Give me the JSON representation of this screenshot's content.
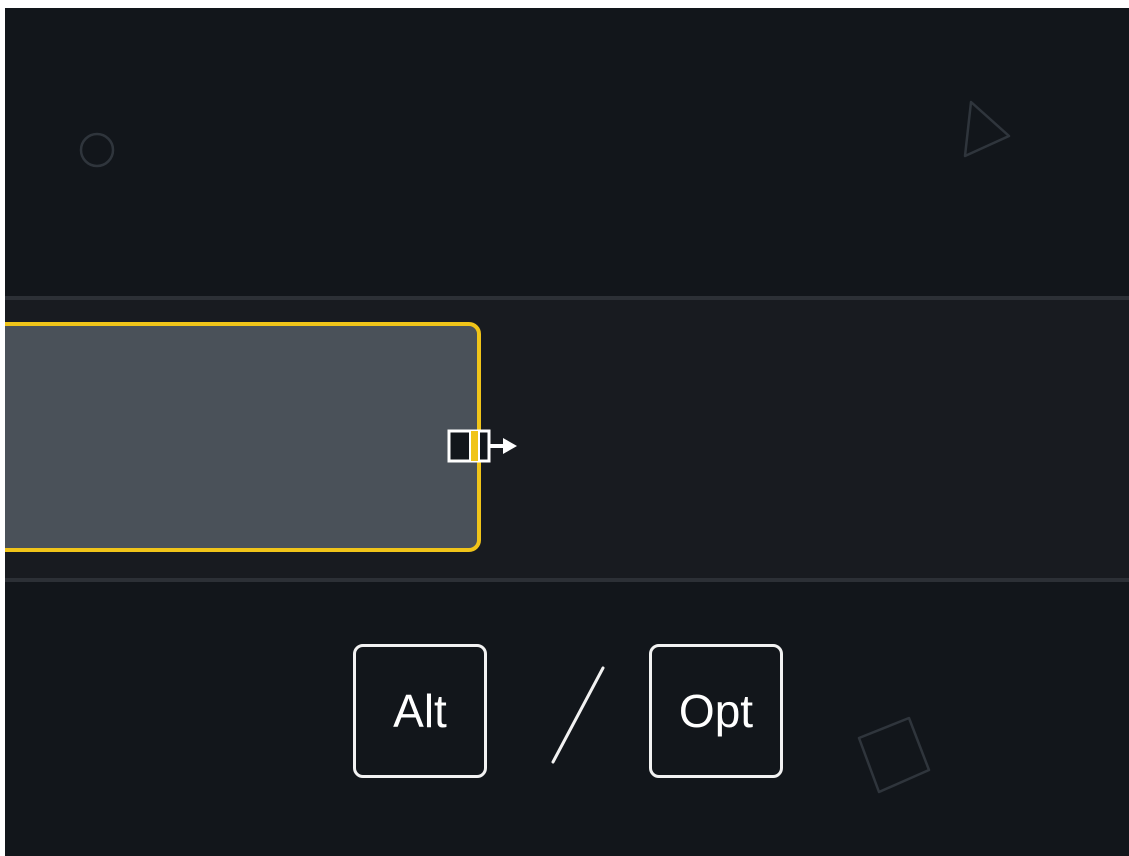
{
  "timeline": {
    "clip_border_color": "#f0c419",
    "clip_fill_color": "#4a5159",
    "track_color": "#181b20",
    "background_color": "#12161b",
    "cursor_icon": "trim-end-cursor"
  },
  "decorations": {
    "shapes": [
      "circle-outline-icon",
      "triangle-outline-icon",
      "square-outline-icon"
    ]
  },
  "shortcut": {
    "key_windows": "Alt",
    "key_mac": "Opt",
    "separator": "/"
  }
}
